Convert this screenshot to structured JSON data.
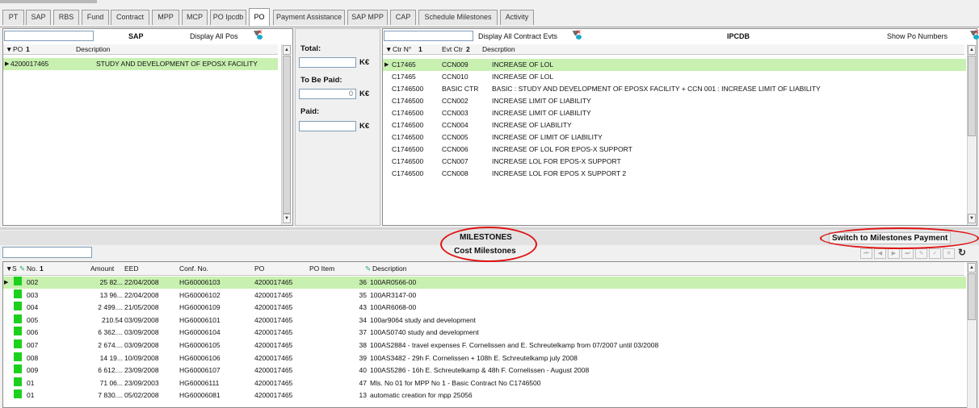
{
  "tabs": [
    "PT",
    "SAP",
    "RBS",
    "Fund",
    "Contract",
    "MPP",
    "MCP",
    "PO Ipcdb",
    "PO",
    "Payment Assistance",
    "SAP MPP",
    "CAP",
    "Schedule Milestones",
    "Activity"
  ],
  "sap": {
    "title": "SAP",
    "display_all": "Display All Pos",
    "columns": {
      "po": "PO",
      "po_sort": "1",
      "description": "Description"
    },
    "rows": [
      {
        "po": "4200017465",
        "description": "STUDY AND DEVELOPMENT OF EPOSX FACILITY"
      }
    ]
  },
  "totals": {
    "total_label": "Total:",
    "total_value": "",
    "to_be_paid_label": "To Be Paid:",
    "to_be_paid_value": "0",
    "paid_label": "Paid:",
    "paid_value": "",
    "unit": "K€"
  },
  "ipcdb": {
    "title": "IPCDB",
    "display_all": "Display All Contract Evts",
    "show_po": "Show Po Numbers",
    "columns": {
      "ctr": "Ctr N°",
      "ctr_sort": "1",
      "evt": "Evt Ctr",
      "evt_sort": "2",
      "description": "Descrption"
    },
    "rows": [
      {
        "ctr": "C17465",
        "evt": "CCN009",
        "description": "INCREASE OF LOL"
      },
      {
        "ctr": "C17465",
        "evt": "CCN010",
        "description": "INCREASE OF LOL"
      },
      {
        "ctr": "C1746500",
        "evt": "BASIC CTR",
        "description": "BASIC : STUDY AND DEVELOPMENT OF EPOSX FACILITY + CCN 001 : INCREASE LIMIT OF LIABILITY"
      },
      {
        "ctr": "C1746500",
        "evt": "CCN002",
        "description": "INCREASE LIMIT OF LIABILITY"
      },
      {
        "ctr": "C1746500",
        "evt": "CCN003",
        "description": "INCREASE LIMIT OF LIABILITY"
      },
      {
        "ctr": "C1746500",
        "evt": "CCN004",
        "description": "INCREASE OF LIABILITY"
      },
      {
        "ctr": "C1746500",
        "evt": "CCN005",
        "description": "INCREASE OF LIMIT OF LIABILITY"
      },
      {
        "ctr": "C1746500",
        "evt": "CCN006",
        "description": "INCREASE OF LOL FOR EPOS-X SUPPORT"
      },
      {
        "ctr": "C1746500",
        "evt": "CCN007",
        "description": "INCREASE LOL FOR EPOS-X SUPPORT"
      },
      {
        "ctr": "C1746500",
        "evt": "CCN008",
        "description": "INCREASE LOL FOR EPOS X SUPPORT 2"
      }
    ]
  },
  "milestones": {
    "title": "MILESTONES",
    "subtitle": "Cost Milestones",
    "switch_label": "Switch to Milestones Payment",
    "columns": {
      "s": "S",
      "no": "No.",
      "no_sort": "1",
      "amount": "Amount",
      "eed": "EED",
      "conf": "Conf. No.",
      "po": "PO",
      "po_item": "PO Item",
      "description": "Description"
    },
    "rows": [
      {
        "no": "002",
        "amount": "25 82...",
        "eed": "22/04/2008",
        "conf": "HG60006103",
        "po": "4200017465",
        "item": "36",
        "description": "100AR0566-00"
      },
      {
        "no": "003",
        "amount": "13 96...",
        "eed": "22/04/2008",
        "conf": "HG60006102",
        "po": "4200017465",
        "item": "35",
        "description": "100AR3147-00"
      },
      {
        "no": "004",
        "amount": "2 499....",
        "eed": "21/05/2008",
        "conf": "HG60006109",
        "po": "4200017465",
        "item": "43",
        "description": "100AR6068-00"
      },
      {
        "no": "005",
        "amount": "210.54",
        "eed": "03/09/2008",
        "conf": "HG60006101",
        "po": "4200017465",
        "item": "34",
        "description": "100ar9064 study and development"
      },
      {
        "no": "006",
        "amount": "6 362....",
        "eed": "03/09/2008",
        "conf": "HG60006104",
        "po": "4200017465",
        "item": "37",
        "description": "100AS0740 study and development"
      },
      {
        "no": "007",
        "amount": "2 674....",
        "eed": "03/09/2008",
        "conf": "HG60006105",
        "po": "4200017465",
        "item": "38",
        "description": "100AS2884 - travel expenses F. Cornelissen and E. Schreutelkamp from 07/2007 until 03/2008"
      },
      {
        "no": "008",
        "amount": "14 19...",
        "eed": "10/09/2008",
        "conf": "HG60006106",
        "po": "4200017465",
        "item": "39",
        "description": "100AS3482 - 29h F. Cornelissen + 108h E. Schreutelkamp july 2008"
      },
      {
        "no": "009",
        "amount": "6 612....",
        "eed": "23/09/2008",
        "conf": "HG60006107",
        "po": "4200017465",
        "item": "40",
        "description": "100AS5286 - 16h E. Schreutelkamp & 48h F. Cornelissen  - August 2008"
      },
      {
        "no": "01",
        "amount": "71 06...",
        "eed": "23/09/2003",
        "conf": "HG60006111",
        "po": "4200017465",
        "item": "47",
        "description": "Mls. No 01 for MPP No 1 - Basic Contract No C1746500"
      },
      {
        "no": "01",
        "amount": "7 830....",
        "eed": "05/02/2008",
        "conf": "HG60006081",
        "po": "4200017465",
        "item": "13",
        "description": "automatic creation  for mpp 25056"
      }
    ]
  },
  "colors": {
    "selected_row": "#c8f0b0",
    "status_green": "#1cd11c",
    "annotation_red": "#e01414"
  }
}
